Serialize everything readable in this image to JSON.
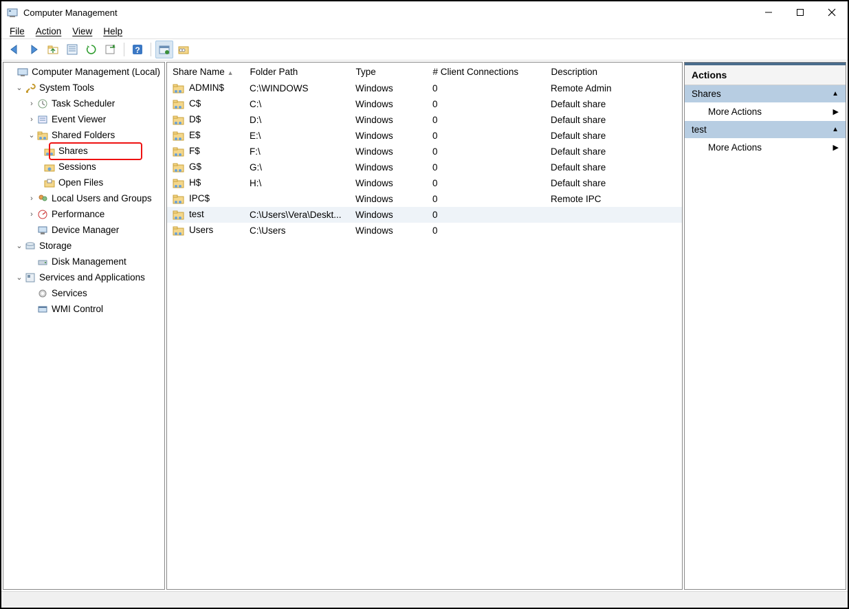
{
  "window": {
    "title": "Computer Management"
  },
  "menu": {
    "file": "File",
    "action": "Action",
    "view": "View",
    "help": "Help"
  },
  "toolbar_icons": [
    "back",
    "forward",
    "up-folder",
    "properties",
    "refresh",
    "export",
    "sep",
    "help",
    "sep",
    "new-share",
    "manage"
  ],
  "tree": {
    "root": "Computer Management (Local)",
    "system_tools": "System Tools",
    "task_scheduler": "Task Scheduler",
    "event_viewer": "Event Viewer",
    "shared_folders": "Shared Folders",
    "shares": "Shares",
    "sessions": "Sessions",
    "open_files": "Open Files",
    "local_users": "Local Users and Groups",
    "performance": "Performance",
    "device_manager": "Device Manager",
    "storage": "Storage",
    "disk_management": "Disk Management",
    "services_apps": "Services and Applications",
    "services": "Services",
    "wmi_control": "WMI Control"
  },
  "columns": {
    "share_name": "Share Name",
    "folder_path": "Folder Path",
    "type": "Type",
    "clients": "# Client Connections",
    "description": "Description"
  },
  "shares": [
    {
      "name": "ADMIN$",
      "path": "C:\\WINDOWS",
      "type": "Windows",
      "clients": "0",
      "desc": "Remote Admin"
    },
    {
      "name": "C$",
      "path": "C:\\",
      "type": "Windows",
      "clients": "0",
      "desc": "Default share"
    },
    {
      "name": "D$",
      "path": "D:\\",
      "type": "Windows",
      "clients": "0",
      "desc": "Default share"
    },
    {
      "name": "E$",
      "path": "E:\\",
      "type": "Windows",
      "clients": "0",
      "desc": "Default share"
    },
    {
      "name": "F$",
      "path": "F:\\",
      "type": "Windows",
      "clients": "0",
      "desc": "Default share"
    },
    {
      "name": "G$",
      "path": "G:\\",
      "type": "Windows",
      "clients": "0",
      "desc": "Default share"
    },
    {
      "name": "H$",
      "path": "H:\\",
      "type": "Windows",
      "clients": "0",
      "desc": "Default share"
    },
    {
      "name": "IPC$",
      "path": "",
      "type": "Windows",
      "clients": "0",
      "desc": "Remote IPC"
    },
    {
      "name": "test",
      "path": "C:\\Users\\Vera\\Deskt...",
      "type": "Windows",
      "clients": "0",
      "desc": "",
      "selected": true
    },
    {
      "name": "Users",
      "path": "C:\\Users",
      "type": "Windows",
      "clients": "0",
      "desc": ""
    }
  ],
  "actions": {
    "title": "Actions",
    "group1": "Shares",
    "group2": "test",
    "more": "More Actions"
  }
}
